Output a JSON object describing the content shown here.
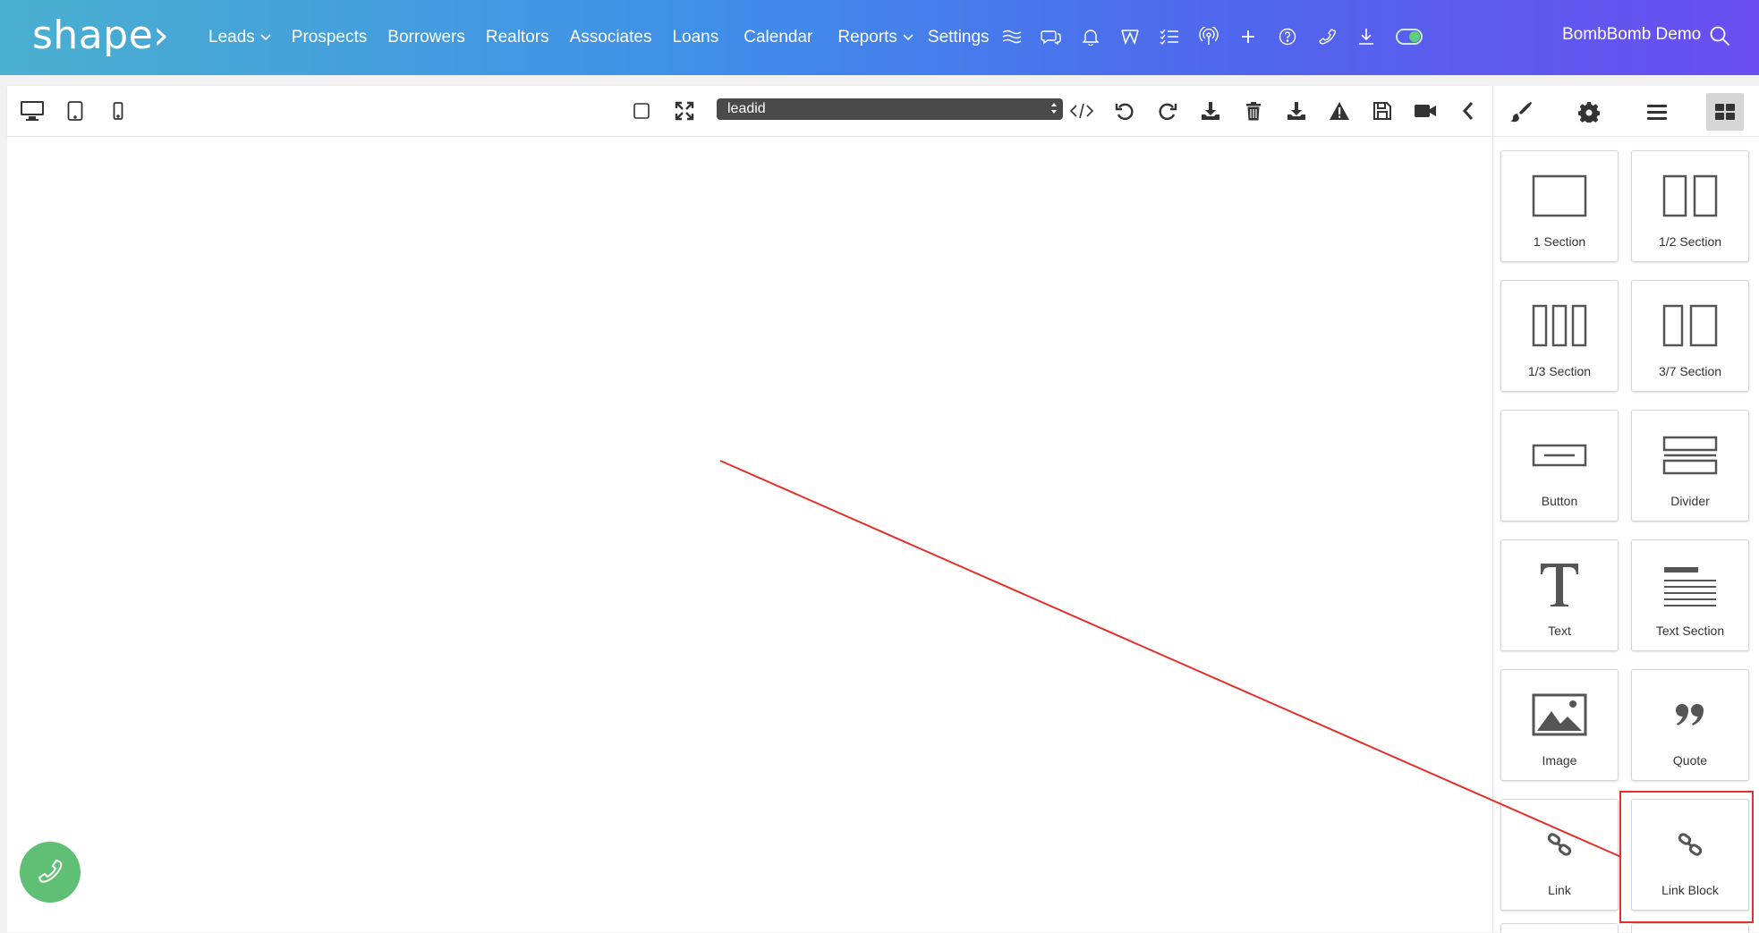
{
  "app": {
    "logo_text": "shape",
    "logo_glyph": "›"
  },
  "nav": {
    "items": [
      {
        "label": "Leads",
        "dropdown": true
      },
      {
        "label": "Prospects",
        "dropdown": false
      },
      {
        "label": "Borrowers",
        "dropdown": false
      },
      {
        "label": "Realtors",
        "dropdown": false
      },
      {
        "label": "Associates",
        "dropdown": false
      },
      {
        "label": "Loans",
        "dropdown": false
      },
      {
        "label": "Calendar",
        "dropdown": false
      },
      {
        "label": "Reports",
        "dropdown": true
      },
      {
        "label": "Settings",
        "dropdown": false
      }
    ],
    "icons": [
      "waves-icon",
      "chat-icon",
      "bell-icon",
      "w-logo-icon",
      "checklist-icon",
      "broadcast-icon",
      "plus-icon",
      "help-icon",
      "phone-icon",
      "download-icon"
    ],
    "toggle_on": true,
    "account_label": "BombBomb Demo"
  },
  "toolbar": {
    "device_icons": [
      "desktop-icon",
      "tablet-icon",
      "mobile-icon"
    ],
    "select_value": "leadid",
    "action_icons": [
      "square-icon",
      "fullscreen-icon",
      "code-icon",
      "undo-icon",
      "redo-icon",
      "import-icon",
      "trash-icon",
      "download-icon",
      "warning-icon",
      "save-icon",
      "video-icon",
      "collapse-icon"
    ]
  },
  "panel": {
    "tabs": [
      "brush-icon",
      "gear-icon",
      "layers-icon",
      "blocks-icon"
    ],
    "active_tab": "blocks-icon",
    "blocks": [
      {
        "label": "1 Section",
        "icon": "one-section-icon"
      },
      {
        "label": "1/2 Section",
        "icon": "half-section-icon"
      },
      {
        "label": "1/3 Section",
        "icon": "third-section-icon"
      },
      {
        "label": "3/7 Section",
        "icon": "three-seven-section-icon"
      },
      {
        "label": "Button",
        "icon": "button-block-icon"
      },
      {
        "label": "Divider",
        "icon": "divider-block-icon"
      },
      {
        "label": "Text",
        "icon": "text-block-icon"
      },
      {
        "label": "Text Section",
        "icon": "text-section-icon"
      },
      {
        "label": "Image",
        "icon": "image-block-icon"
      },
      {
        "label": "Quote",
        "icon": "quote-icon"
      },
      {
        "label": "Link",
        "icon": "link-icon"
      },
      {
        "label": "Link Block",
        "icon": "link-block-icon"
      }
    ],
    "highlighted_block": "Link Block"
  },
  "colors": {
    "accent_red": "#e5302a",
    "call_button": "#5fbf75",
    "nav_gradient_start": "#4ab0cf",
    "nav_gradient_end": "#6a4ef0"
  }
}
